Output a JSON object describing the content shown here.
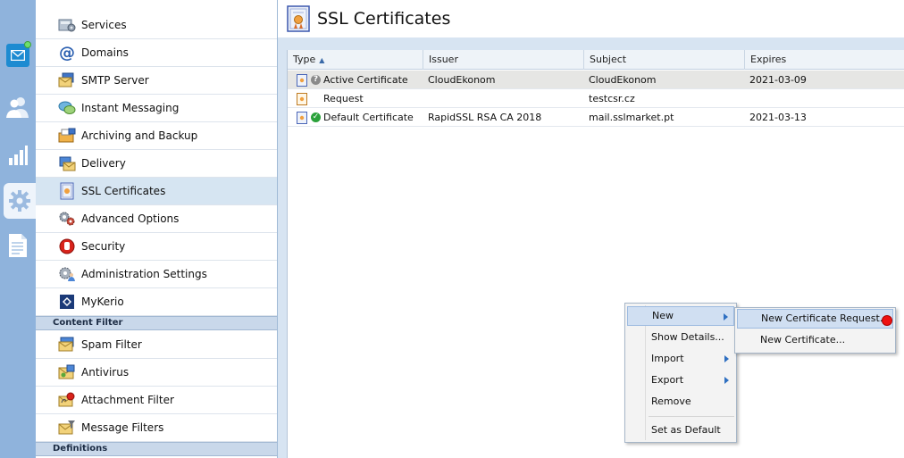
{
  "nav": {
    "items": [
      {
        "label": "Services",
        "icon": "services-icon"
      },
      {
        "label": "Domains",
        "icon": "at-icon"
      },
      {
        "label": "SMTP Server",
        "icon": "smtp-server-icon"
      },
      {
        "label": "Instant Messaging",
        "icon": "chat-bubbles-icon"
      },
      {
        "label": "Archiving and Backup",
        "icon": "archive-icon"
      },
      {
        "label": "Delivery",
        "icon": "delivery-icon"
      },
      {
        "label": "SSL Certificates",
        "icon": "certificate-icon"
      },
      {
        "label": "Advanced Options",
        "icon": "gears-icon"
      },
      {
        "label": "Security",
        "icon": "stop-hand-icon"
      },
      {
        "label": "Administration Settings",
        "icon": "admin-settings-icon"
      },
      {
        "label": "MyKerio",
        "icon": "mykerio-icon"
      }
    ],
    "content_filter_header": "Content Filter",
    "content_filter_items": [
      {
        "label": "Spam Filter",
        "icon": "spam-filter-icon"
      },
      {
        "label": "Antivirus",
        "icon": "antivirus-icon"
      },
      {
        "label": "Attachment Filter",
        "icon": "attachment-filter-icon"
      },
      {
        "label": "Message Filters",
        "icon": "message-filters-icon"
      }
    ],
    "definitions_header": "Definitions"
  },
  "page": {
    "title": "SSL Certificates"
  },
  "grid": {
    "columns": [
      "Type",
      "Issuer",
      "Subject",
      "Expires"
    ],
    "rows": [
      {
        "type": "Active Certificate",
        "issuer": "CloudEkonom",
        "subject": "CloudEkonom",
        "expires": "2021-03-09",
        "status": "unknown"
      },
      {
        "type": "Request",
        "issuer": "",
        "subject": "testcsr.cz",
        "expires": "",
        "status": "none"
      },
      {
        "type": "Default Certificate",
        "issuer": "RapidSSL RSA CA 2018",
        "subject": "mail.sslmarket.pt",
        "expires": "2021-03-13",
        "status": "valid"
      }
    ]
  },
  "context_menu": {
    "new": "New",
    "show_details": "Show Details...",
    "import": "Import",
    "export": "Export",
    "remove": "Remove",
    "set_default": "Set as Default"
  },
  "submenu": {
    "new_request": "New Certificate Request...",
    "new_certificate": "New Certificate..."
  },
  "colors": {
    "rail": "#8fb3dc",
    "selected_nav": "#d6e5f2",
    "valid_status": "#2aa13a",
    "unknown_status": "#8a8a8a",
    "cursor_marker": "#ee1111"
  }
}
